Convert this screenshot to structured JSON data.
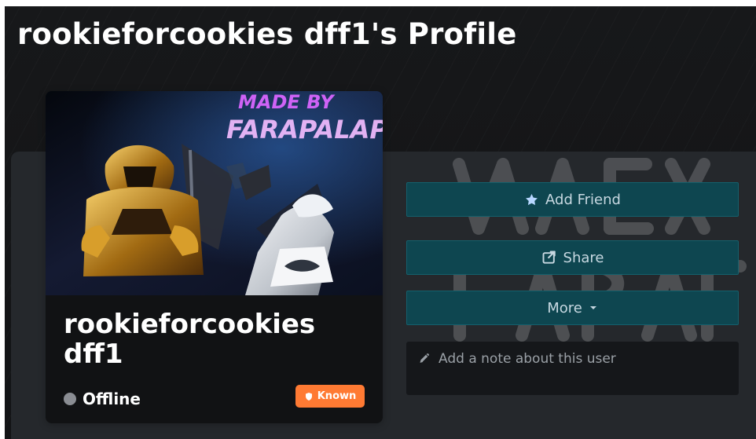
{
  "page": {
    "title": "rookieforcookies dff1's Profile"
  },
  "profile_card": {
    "username": "rookieforcookies dff1",
    "status_label": "Offline",
    "trust_badge": "Known",
    "image_caption_line_1": "MADE BY",
    "image_caption_line_2": "FARAPALAP"
  },
  "actions": {
    "add_friend_label": "Add Friend",
    "share_label": "Share",
    "more_label": "More"
  },
  "note": {
    "placeholder": "Add a note about this user"
  },
  "icons": {
    "star": "star-icon",
    "share": "share-icon",
    "dropdown": "chevron-down-icon",
    "pencil": "pencil-icon",
    "shield": "shield-icon",
    "status": "status-dot-icon"
  },
  "colors": {
    "background": "#151619",
    "panel": "#25282c",
    "card": "#111214",
    "action_button": "#0e4650",
    "action_button_text": "#c7d8e1",
    "status_offline": "#8a8d93",
    "badge_known": "#ff7a33",
    "note_box": "#15171a"
  }
}
